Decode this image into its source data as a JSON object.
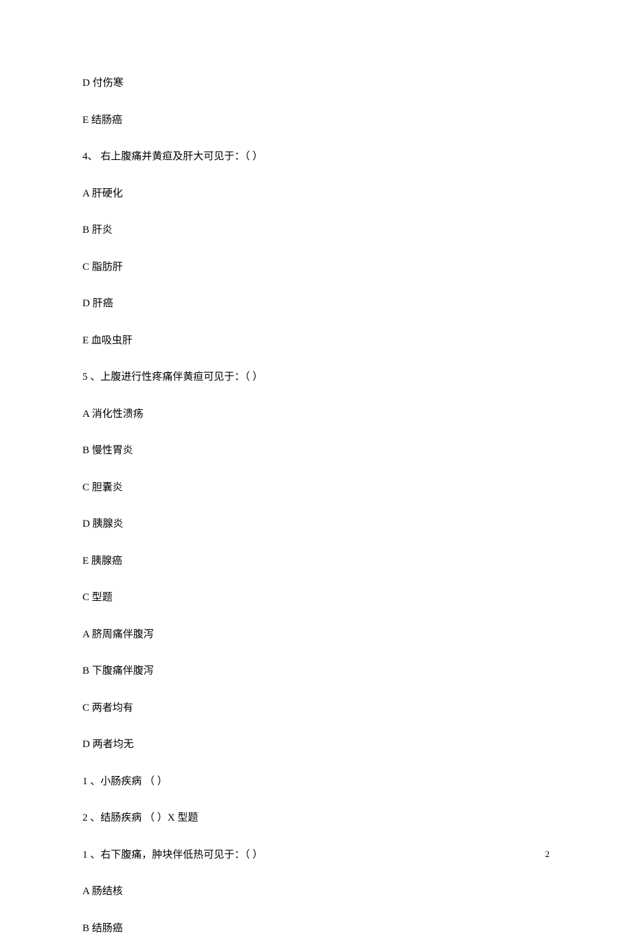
{
  "lines": [
    "D 付伤寒",
    "E 结肠癌",
    "4、 右上腹痛并黄疸及肝大可见于：（  ）",
    "A 肝硬化",
    "B 肝炎",
    "C 脂肪肝",
    "D 肝癌",
    "E 血吸虫肝",
    "5 、上腹进行性疼痛伴黄疸可见于：（  ）",
    "A 消化性溃疡",
    "B 慢性胃炎",
    "C 胆囊炎",
    "D 胰腺炎",
    "E 胰腺癌",
    "C 型题",
    "A 脐周痛伴腹泻",
    "B 下腹痛伴腹泻",
    "C 两者均有",
    "D 两者均无",
    "1 、小肠疾病  （  ）",
    "2 、结肠疾病  （  ）X 型题",
    "1 、右下腹痛，肿块伴低热可见于：（   ）",
    "A 肠结核",
    "B 结肠癌"
  ],
  "pageNumber": "2"
}
